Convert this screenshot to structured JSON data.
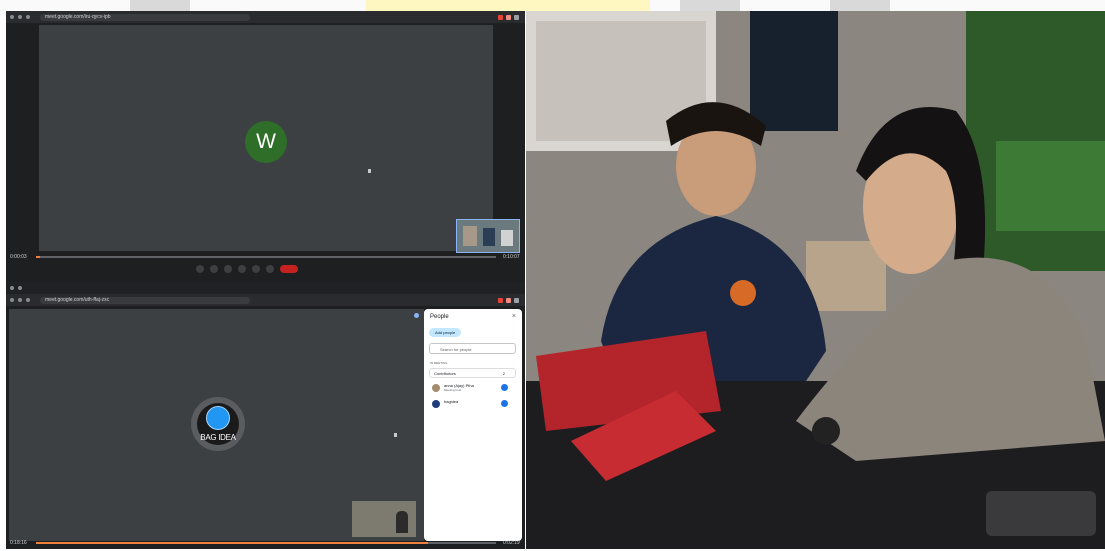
{
  "top_window": {
    "url": "meet.google.com/iru-qycv-ipb",
    "avatar_letter": "W",
    "time_left": "0:00:03",
    "time_right": "0:10:07"
  },
  "bottom_window": {
    "url": "meet.google.com/uth-ffaj-zxc",
    "logo_text": "BAG IDEA",
    "time_left": "0:18:16",
    "time_right": "0:02:19",
    "people_panel": {
      "title": "People",
      "close_icon": "close-icon",
      "add_people": "Add people",
      "search_placeholder": "Search for people",
      "section_label": "IN MEETING",
      "group_label": "Contributors",
      "group_count": "2",
      "participants": [
        {
          "name": "anna (Ajay) Ptha",
          "role": "Meeting host"
        },
        {
          "name": "bagidea",
          "role": ""
        }
      ]
    }
  },
  "colors": {
    "meet_bg": "#3c4043",
    "avatar_green": "#2f6e28",
    "accent_orange": "#f0803c",
    "end_call_red": "#c5221f",
    "blue": "#1a73e8"
  }
}
